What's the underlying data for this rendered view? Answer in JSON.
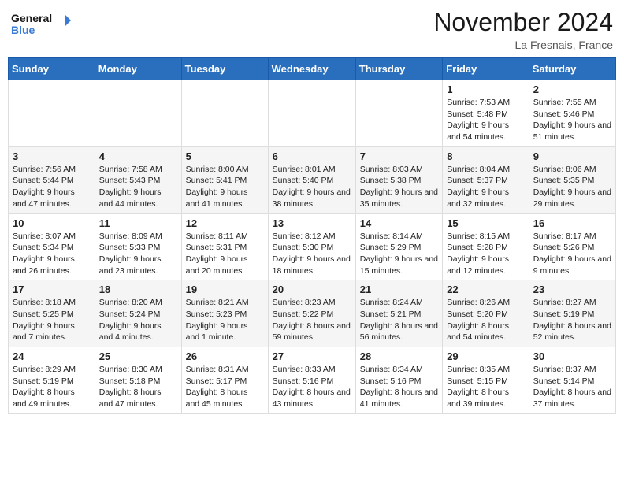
{
  "header": {
    "logo_line1": "General",
    "logo_line2": "Blue",
    "month_title": "November 2024",
    "location": "La Fresnais, France"
  },
  "weekdays": [
    "Sunday",
    "Monday",
    "Tuesday",
    "Wednesday",
    "Thursday",
    "Friday",
    "Saturday"
  ],
  "weeks": [
    [
      {
        "day": "",
        "info": ""
      },
      {
        "day": "",
        "info": ""
      },
      {
        "day": "",
        "info": ""
      },
      {
        "day": "",
        "info": ""
      },
      {
        "day": "",
        "info": ""
      },
      {
        "day": "1",
        "info": "Sunrise: 7:53 AM\nSunset: 5:48 PM\nDaylight: 9 hours and 54 minutes."
      },
      {
        "day": "2",
        "info": "Sunrise: 7:55 AM\nSunset: 5:46 PM\nDaylight: 9 hours and 51 minutes."
      }
    ],
    [
      {
        "day": "3",
        "info": "Sunrise: 7:56 AM\nSunset: 5:44 PM\nDaylight: 9 hours and 47 minutes."
      },
      {
        "day": "4",
        "info": "Sunrise: 7:58 AM\nSunset: 5:43 PM\nDaylight: 9 hours and 44 minutes."
      },
      {
        "day": "5",
        "info": "Sunrise: 8:00 AM\nSunset: 5:41 PM\nDaylight: 9 hours and 41 minutes."
      },
      {
        "day": "6",
        "info": "Sunrise: 8:01 AM\nSunset: 5:40 PM\nDaylight: 9 hours and 38 minutes."
      },
      {
        "day": "7",
        "info": "Sunrise: 8:03 AM\nSunset: 5:38 PM\nDaylight: 9 hours and 35 minutes."
      },
      {
        "day": "8",
        "info": "Sunrise: 8:04 AM\nSunset: 5:37 PM\nDaylight: 9 hours and 32 minutes."
      },
      {
        "day": "9",
        "info": "Sunrise: 8:06 AM\nSunset: 5:35 PM\nDaylight: 9 hours and 29 minutes."
      }
    ],
    [
      {
        "day": "10",
        "info": "Sunrise: 8:07 AM\nSunset: 5:34 PM\nDaylight: 9 hours and 26 minutes."
      },
      {
        "day": "11",
        "info": "Sunrise: 8:09 AM\nSunset: 5:33 PM\nDaylight: 9 hours and 23 minutes."
      },
      {
        "day": "12",
        "info": "Sunrise: 8:11 AM\nSunset: 5:31 PM\nDaylight: 9 hours and 20 minutes."
      },
      {
        "day": "13",
        "info": "Sunrise: 8:12 AM\nSunset: 5:30 PM\nDaylight: 9 hours and 18 minutes."
      },
      {
        "day": "14",
        "info": "Sunrise: 8:14 AM\nSunset: 5:29 PM\nDaylight: 9 hours and 15 minutes."
      },
      {
        "day": "15",
        "info": "Sunrise: 8:15 AM\nSunset: 5:28 PM\nDaylight: 9 hours and 12 minutes."
      },
      {
        "day": "16",
        "info": "Sunrise: 8:17 AM\nSunset: 5:26 PM\nDaylight: 9 hours and 9 minutes."
      }
    ],
    [
      {
        "day": "17",
        "info": "Sunrise: 8:18 AM\nSunset: 5:25 PM\nDaylight: 9 hours and 7 minutes."
      },
      {
        "day": "18",
        "info": "Sunrise: 8:20 AM\nSunset: 5:24 PM\nDaylight: 9 hours and 4 minutes."
      },
      {
        "day": "19",
        "info": "Sunrise: 8:21 AM\nSunset: 5:23 PM\nDaylight: 9 hours and 1 minute."
      },
      {
        "day": "20",
        "info": "Sunrise: 8:23 AM\nSunset: 5:22 PM\nDaylight: 8 hours and 59 minutes."
      },
      {
        "day": "21",
        "info": "Sunrise: 8:24 AM\nSunset: 5:21 PM\nDaylight: 8 hours and 56 minutes."
      },
      {
        "day": "22",
        "info": "Sunrise: 8:26 AM\nSunset: 5:20 PM\nDaylight: 8 hours and 54 minutes."
      },
      {
        "day": "23",
        "info": "Sunrise: 8:27 AM\nSunset: 5:19 PM\nDaylight: 8 hours and 52 minutes."
      }
    ],
    [
      {
        "day": "24",
        "info": "Sunrise: 8:29 AM\nSunset: 5:19 PM\nDaylight: 8 hours and 49 minutes."
      },
      {
        "day": "25",
        "info": "Sunrise: 8:30 AM\nSunset: 5:18 PM\nDaylight: 8 hours and 47 minutes."
      },
      {
        "day": "26",
        "info": "Sunrise: 8:31 AM\nSunset: 5:17 PM\nDaylight: 8 hours and 45 minutes."
      },
      {
        "day": "27",
        "info": "Sunrise: 8:33 AM\nSunset: 5:16 PM\nDaylight: 8 hours and 43 minutes."
      },
      {
        "day": "28",
        "info": "Sunrise: 8:34 AM\nSunset: 5:16 PM\nDaylight: 8 hours and 41 minutes."
      },
      {
        "day": "29",
        "info": "Sunrise: 8:35 AM\nSunset: 5:15 PM\nDaylight: 8 hours and 39 minutes."
      },
      {
        "day": "30",
        "info": "Sunrise: 8:37 AM\nSunset: 5:14 PM\nDaylight: 8 hours and 37 minutes."
      }
    ]
  ]
}
